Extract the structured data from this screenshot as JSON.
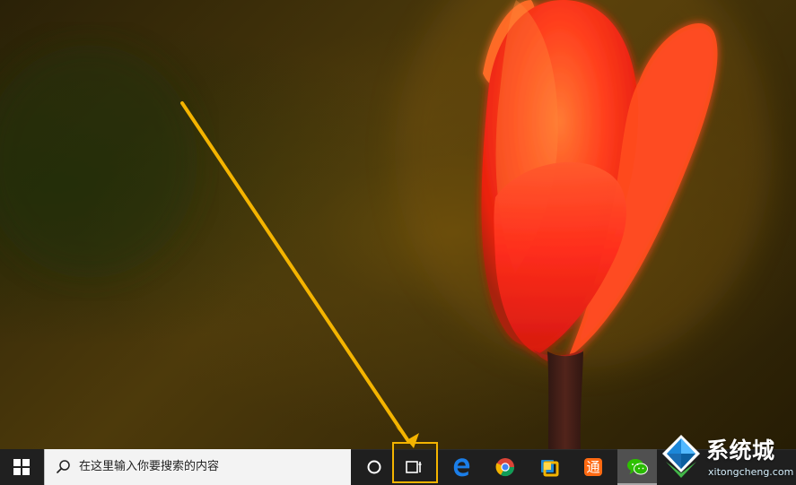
{
  "taskbar": {
    "search_placeholder": "在这里输入你要搜索的内容",
    "apps": [
      {
        "icon": "microsoft-edge-icon"
      },
      {
        "icon": "google-chrome-icon"
      },
      {
        "icon": "vmware-icon"
      },
      {
        "icon": "tongbu-icon"
      },
      {
        "icon": "wechat-icon"
      }
    ],
    "highlight_color": "#f4b400"
  },
  "watermark": {
    "title": "系统城",
    "subtitle": "xitongcheng.com"
  },
  "colors": {
    "taskbar": "#1f1f1f",
    "search_box": "#f3f3f3",
    "arrow": "#f4b400",
    "tulip": "#ff4a1f"
  }
}
